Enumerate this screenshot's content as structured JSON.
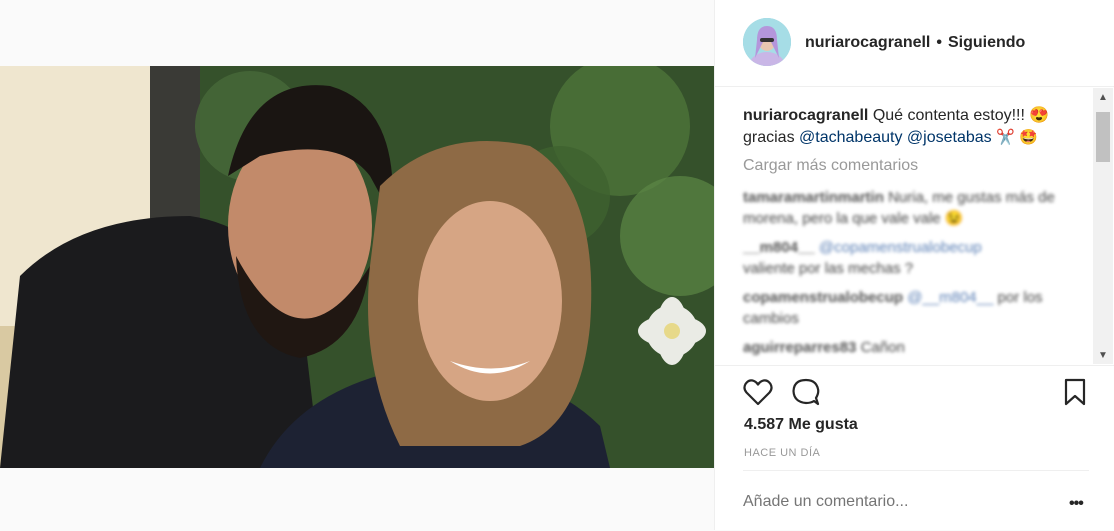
{
  "post": {
    "author": "nuriarocagranell",
    "separator": "•",
    "follow_state": "Siguiendo",
    "caption": {
      "text": "Qué contenta estoy!!! 😍",
      "line2_prefix": "gracias ",
      "mentions": [
        "@tachabeauty",
        "@josetabas"
      ],
      "trailing_emojis": "✂️ 🤩"
    },
    "load_more": "Cargar más comentarios",
    "comments": [
      {
        "user": "tamaramartinmartin",
        "text": "Nuria, me gustas más de morena, pero la que vale vale 😉"
      },
      {
        "user": "__m804__",
        "mention": "@copamenstrualobecup",
        "text": "valiente por las mechas ?"
      },
      {
        "user": "copamenstrualobecup",
        "mention": "@__m804__",
        "text": "por los cambios"
      },
      {
        "user": "aguirreparres83",
        "text": "Cañon"
      }
    ],
    "likes": "4.587 Me gusta",
    "timestamp": "HACE UN DÍA",
    "comment_placeholder": "Añade un comentario...",
    "more_label": "•••"
  },
  "icons": {
    "like": "heart-icon",
    "comment": "comment-icon",
    "save": "bookmark-icon",
    "options": "more-icon"
  }
}
